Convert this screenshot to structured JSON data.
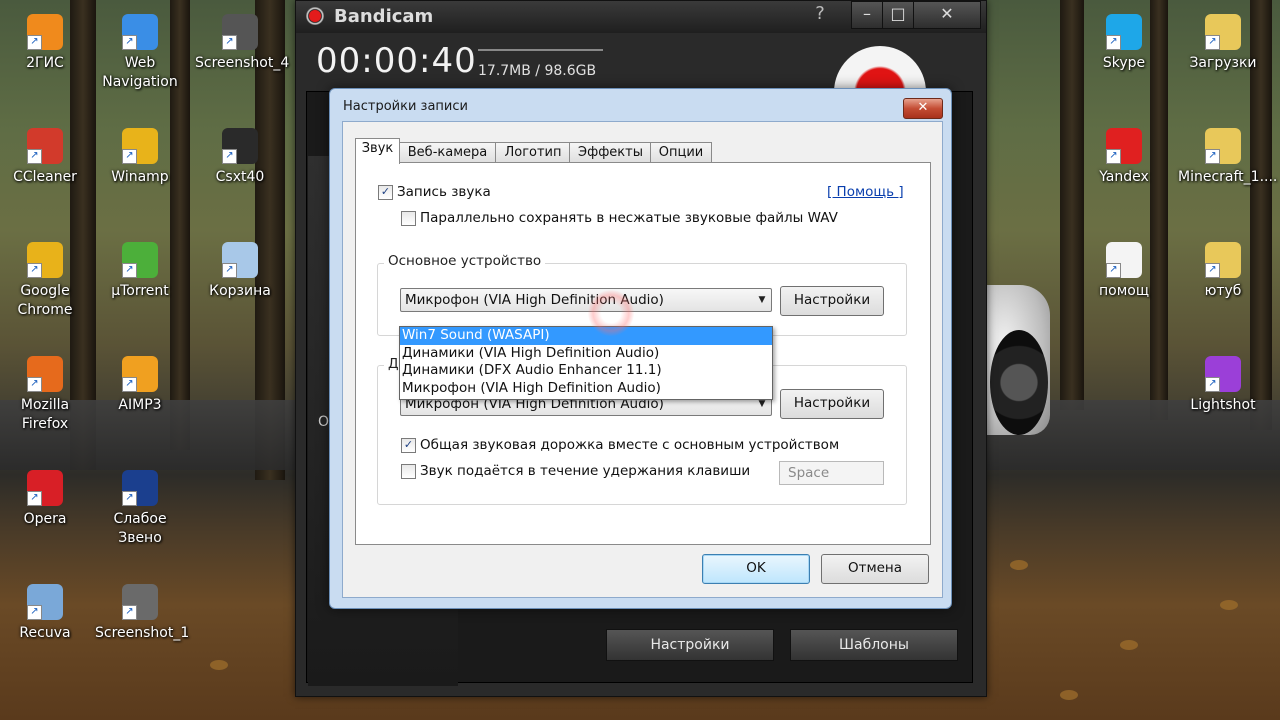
{
  "desktop": {
    "icons_left": [
      {
        "label": "2ГИС",
        "icon": "2gis-icon",
        "color": "#f08a1c"
      },
      {
        "label": "Web Navigation",
        "icon": "globe-icon",
        "color": "#3a8ee6"
      },
      {
        "label": "Screenshot_4",
        "icon": "image-file-icon",
        "color": "#555555"
      },
      {
        "label": "CCleaner",
        "icon": "ccleaner-icon",
        "color": "#d23a2b"
      },
      {
        "label": "Winamp",
        "icon": "winamp-icon",
        "color": "#e8b31a"
      },
      {
        "label": "Csxt40",
        "icon": "video-file-icon",
        "color": "#2a2a2a"
      },
      {
        "label": "Google Chrome",
        "icon": "chrome-icon",
        "color": "#e8b21a"
      },
      {
        "label": "µTorrent",
        "icon": "utorrent-icon",
        "color": "#4caf3a"
      },
      {
        "label": "Корзина",
        "icon": "recycle-bin-icon",
        "color": "#a8c8e8"
      },
      {
        "label": "Mozilla Firefox",
        "icon": "firefox-icon",
        "color": "#e66a1c"
      },
      {
        "label": "AIMP3",
        "icon": "aimp-icon",
        "color": "#f0a020"
      },
      {
        "label": "Opera",
        "icon": "opera-icon",
        "color": "#d81f26"
      },
      {
        "label": "Слабое Звено",
        "icon": "shortcut-app-icon",
        "color": "#1b3f8e"
      },
      {
        "label": "Recuva",
        "icon": "recuva-icon",
        "color": "#7aa8d8"
      },
      {
        "label": "Screenshot_1",
        "icon": "image-file-icon",
        "color": "#6a6a6a"
      }
    ],
    "icons_right": [
      {
        "label": "Skype",
        "icon": "skype-icon",
        "color": "#1ea7e8"
      },
      {
        "label": "Загрузки",
        "icon": "folder-icon",
        "color": "#e8c85a"
      },
      {
        "label": "Yandex",
        "icon": "yandex-icon",
        "color": "#e02020"
      },
      {
        "label": "Minecraft_1....",
        "icon": "folder-icon",
        "color": "#e8c85a"
      },
      {
        "label": "помощ",
        "icon": "text-file-icon",
        "color": "#f4f4f4"
      },
      {
        "label": "ютуб",
        "icon": "folder-icon",
        "color": "#e8c85a"
      },
      {
        "label": "Lightshot",
        "icon": "lightshot-icon",
        "color": "#9b3fd8"
      }
    ]
  },
  "bandicam": {
    "title": "Bandicam",
    "help": "?",
    "minimize": "–",
    "maximize": "□",
    "close": "✕",
    "timer": "00:00:40",
    "size": "17.7MB / 98.6GB",
    "side_label": "O",
    "settings_button": "Настройки",
    "templates_button": "Шаблоны"
  },
  "dialog": {
    "title": "Настройки записи",
    "close": "✕",
    "tabs": [
      "Звук",
      "Веб-камера",
      "Логотип",
      "Эффекты",
      "Опции"
    ],
    "active_tab": "Звук",
    "record_sound": {
      "label": "Запись звука",
      "checked": "✓"
    },
    "help_link": "[ Помощь ]",
    "save_wav": {
      "label": "Параллельно сохранять в несжатые звуковые файлы WAV",
      "checked": ""
    },
    "primary_group": "Основное устройство",
    "primary_device": "Микрофон (VIA High Definition Audio)",
    "primary_settings": "Настройки",
    "dropdown_options": [
      "Win7 Sound (WASAPI)",
      "Динамики (VIA High Definition Audio)",
      "Динамики (DFX Audio Enhancer 11.1)",
      "Микрофон (VIA High Definition Audio)"
    ],
    "secondary_group": "Д",
    "secondary_device": "Микрофон (VIA High Definition Audio)",
    "secondary_settings": "Настройки",
    "mix_track": {
      "label": "Общая звуковая дорожка вместе с основным устройством",
      "checked": "✓"
    },
    "push_to_talk": {
      "label": "Звук подаётся в течение удержания клавиши",
      "checked": ""
    },
    "hotkey": "Space",
    "ok": "OK",
    "cancel": "Отмена"
  }
}
